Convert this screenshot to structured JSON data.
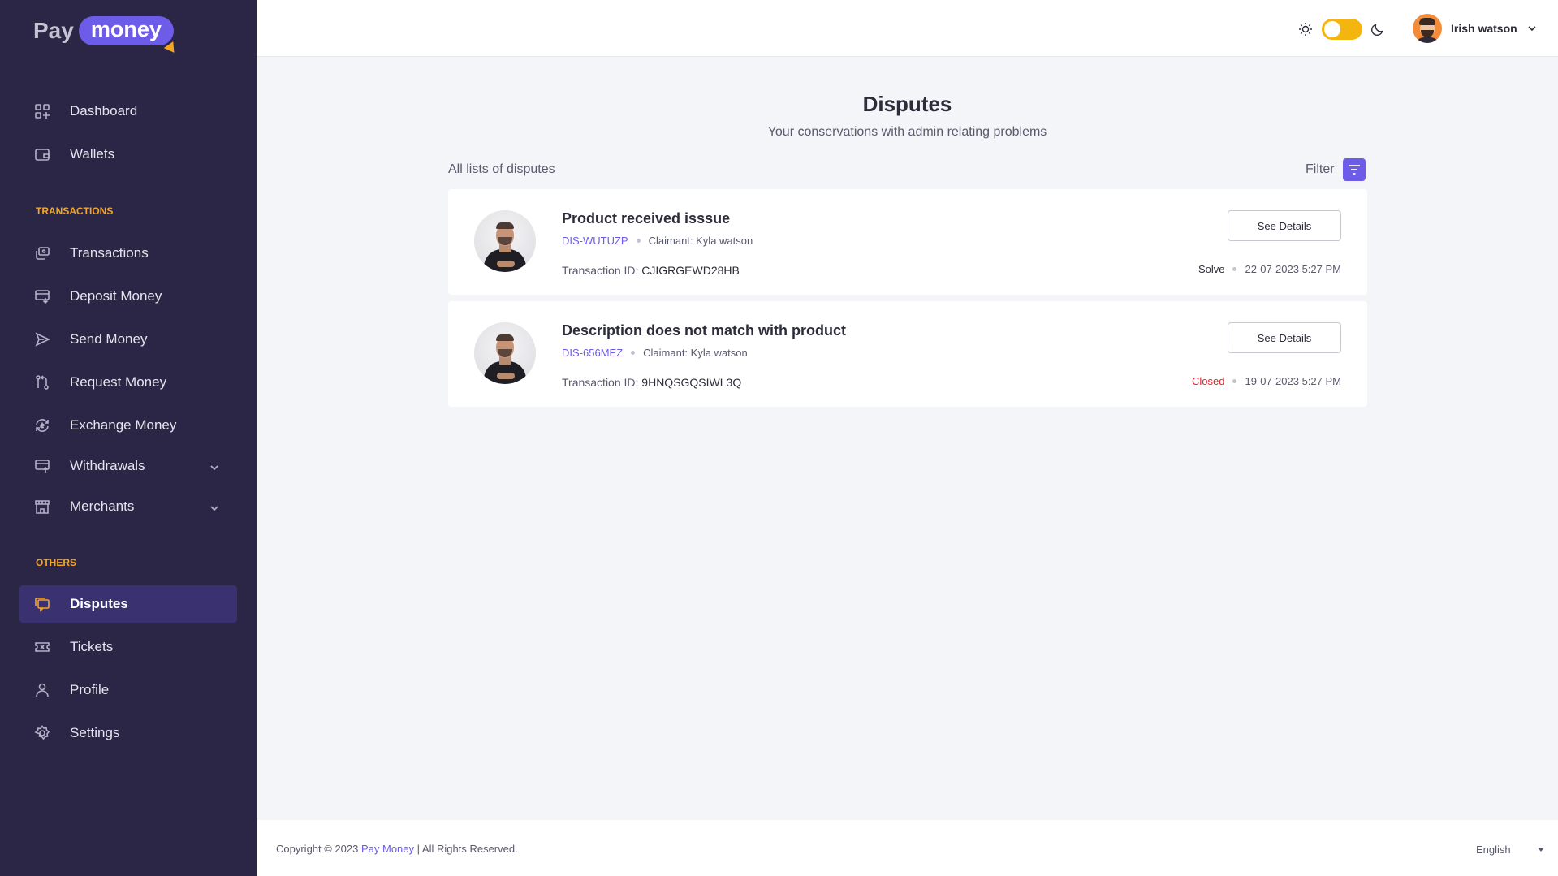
{
  "brand": {
    "logo_pay": "Pay",
    "logo_money": "money"
  },
  "sidebar": {
    "items_top": [
      {
        "label": "Dashboard",
        "icon": "dashboard-icon"
      },
      {
        "label": "Wallets",
        "icon": "wallet-icon"
      }
    ],
    "section_transactions": "TRANSACTIONS",
    "items_transactions": [
      {
        "label": "Transactions",
        "icon": "transactions-icon"
      },
      {
        "label": "Deposit Money",
        "icon": "deposit-icon"
      },
      {
        "label": "Send Money",
        "icon": "send-icon"
      },
      {
        "label": "Request Money",
        "icon": "request-icon"
      },
      {
        "label": "Exchange Money",
        "icon": "exchange-icon"
      },
      {
        "label": "Withdrawals",
        "icon": "withdraw-icon"
      },
      {
        "label": "Merchants",
        "icon": "merchant-icon"
      }
    ],
    "section_others": "OTHERS",
    "items_others": [
      {
        "label": "Disputes",
        "icon": "disputes-icon"
      },
      {
        "label": "Tickets",
        "icon": "ticket-icon"
      },
      {
        "label": "Profile",
        "icon": "profile-icon"
      },
      {
        "label": "Settings",
        "icon": "settings-icon"
      }
    ],
    "active_item": "Disputes"
  },
  "header": {
    "theme_toggle": "light",
    "user_name": "Irish watson"
  },
  "main": {
    "title": "Disputes",
    "subtitle": "Your conservations with admin relating problems",
    "list_label": "All lists of disputes",
    "filter_label": "Filter"
  },
  "disputes": [
    {
      "title": "Product received isssue",
      "id": "DIS-WUTUZP",
      "claimant": "Claimant: Kyla watson",
      "txn_label": "Transaction ID:",
      "txn_id": "CJIGRGEWD28HB",
      "button": "See Details",
      "status": "Solve",
      "date": "22-07-2023 5:27 PM"
    },
    {
      "title": "Description does not match with product",
      "id": "DIS-656MEZ",
      "claimant": "Claimant: Kyla watson",
      "txn_label": "Transaction ID:",
      "txn_id": "9HNQSGQSIWL3Q",
      "button": "See Details",
      "status": "Closed",
      "date": "19-07-2023 5:27 PM"
    }
  ],
  "footer": {
    "copy_prefix": "Copyright © 2023",
    "brand": "Pay Money",
    "copy_suffix": "| All Rights Reserved.",
    "language": "English"
  },
  "colors": {
    "sidebar_bg": "#2b2645",
    "accent": "#6c5ce7",
    "section_label": "#f5a623",
    "closed_status": "#e0232e",
    "toggle": "#f5b50f"
  }
}
